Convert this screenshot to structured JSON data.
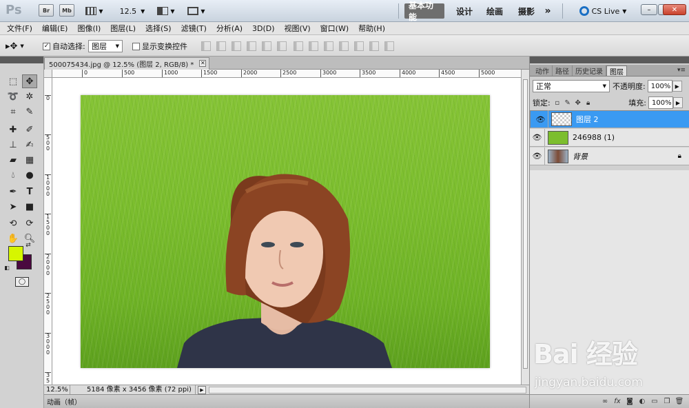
{
  "app": {
    "logo": "Ps",
    "bridge": "Br",
    "minibridge": "Mb",
    "zoom": "12.5",
    "workspaces": [
      "基本功能",
      "设计",
      "绘画",
      "摄影"
    ],
    "more": "»",
    "cslive": "CS Live"
  },
  "window_controls": {
    "minimize": "–",
    "maximize": "□",
    "close": "✕"
  },
  "menu": [
    "文件(F)",
    "编辑(E)",
    "图像(I)",
    "图层(L)",
    "选择(S)",
    "滤镜(T)",
    "分析(A)",
    "3D(D)",
    "视图(V)",
    "窗口(W)",
    "帮助(H)"
  ],
  "options": {
    "auto_select_checked": "✓",
    "auto_select_label": "自动选择:",
    "auto_select_value": "图层",
    "show_transform_label": "显示变换控件"
  },
  "document": {
    "tab_title": "500075434.jpg @ 12.5% (图层 2, RGB/8) *",
    "tab_close": "✕",
    "ruler_h": [
      "0",
      "500",
      "1000",
      "1500",
      "2000",
      "2500",
      "3000",
      "3500",
      "4000",
      "4500",
      "5000"
    ],
    "ruler_v": [
      "0",
      "5 0 0",
      "1 0 0 0",
      "1 5 0 0",
      "2 0 0 0",
      "2 5 0 0",
      "3 0 0 0",
      "3 5"
    ],
    "zoom": "12.5%",
    "info": "5184 像素 x 3456 像素 (72 ppi)",
    "animation_label": "动画（帧）"
  },
  "panels": {
    "tabs": [
      "动作",
      "路径",
      "历史记录",
      "图层"
    ],
    "active_tab": "图层",
    "blend_mode": "正常",
    "opacity_label": "不透明度:",
    "opacity_value": "100%",
    "lock_label": "锁定:",
    "fill_label": "填充:",
    "fill_value": "100%",
    "layers": [
      {
        "name": "图层 2",
        "selected": true
      },
      {
        "name": "246988 (1)",
        "selected": false
      },
      {
        "name": "背景",
        "selected": false,
        "locked": true
      }
    ]
  },
  "watermark": {
    "logo": "Bai 经验",
    "url": "jingyan.baidu.com"
  },
  "colors": {
    "foreground": "#d6f600",
    "background": "#4a0a3f",
    "selection": "#3a9af2"
  }
}
